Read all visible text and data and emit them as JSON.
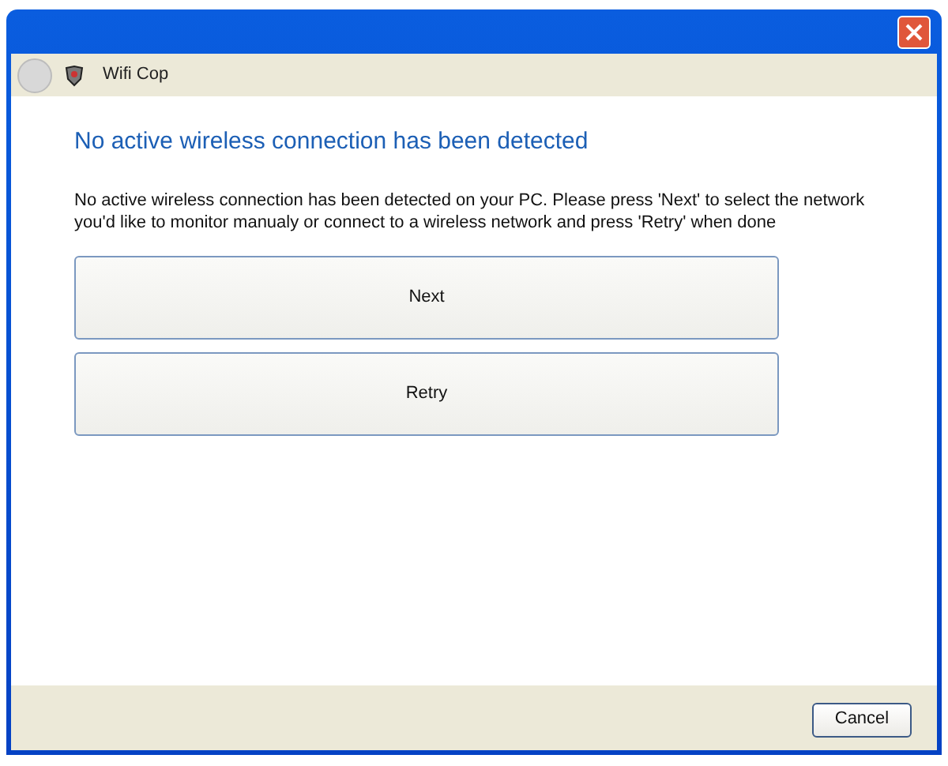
{
  "window": {
    "title": "Wifi Cop"
  },
  "back_button": {
    "disabled": true
  },
  "heading": "No active wireless connection has been detected",
  "message": "No active wireless connection has been detected on your PC. Please press 'Next' to select the network you'd like to monitor manualy or connect to a wireless network and press 'Retry' when done",
  "options": [
    "Next",
    "Retry"
  ],
  "footer": {
    "buttons": [
      "Cancel"
    ]
  }
}
